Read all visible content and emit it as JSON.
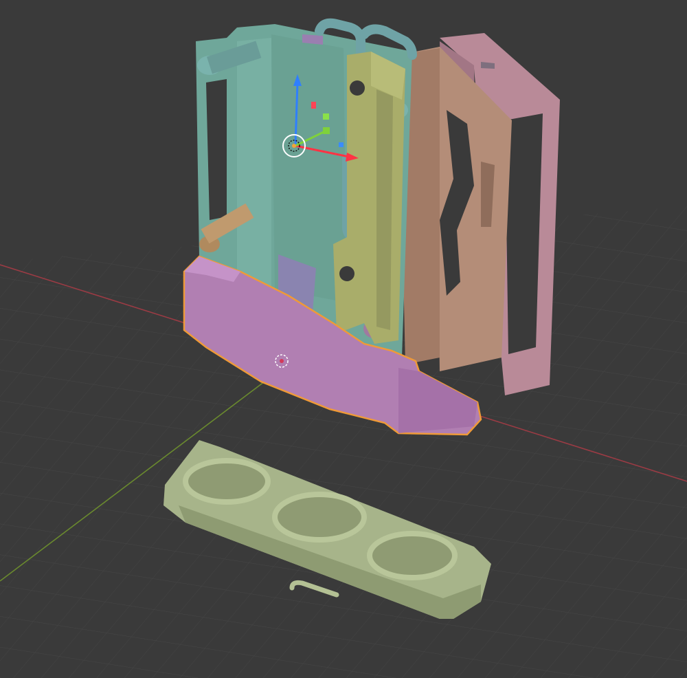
{
  "viewport": {
    "background": "#3a3a3a",
    "grid_color": "#474747",
    "x_axis_color": "#9b3b44",
    "y_axis_color": "#6a8a2e",
    "selection_outline": "#ef9a38"
  },
  "objects": [
    {
      "name": "green-frame",
      "color": "#6fa79a"
    },
    {
      "name": "olive-bracket",
      "color": "#a9ad6a"
    },
    {
      "name": "tan-frame",
      "color": "#b48d78"
    },
    {
      "name": "pink-frame",
      "color": "#b98a98"
    },
    {
      "name": "purple-cover",
      "color": "#b17fb2",
      "selected": true
    },
    {
      "name": "gpu-cooler",
      "color": "#a7b48a"
    }
  ],
  "gizmo": {
    "z_color": "#2f7fff",
    "x_color": "#ff3344",
    "y_color": "#7fd13b",
    "pivot_color": "#f2a23a"
  }
}
